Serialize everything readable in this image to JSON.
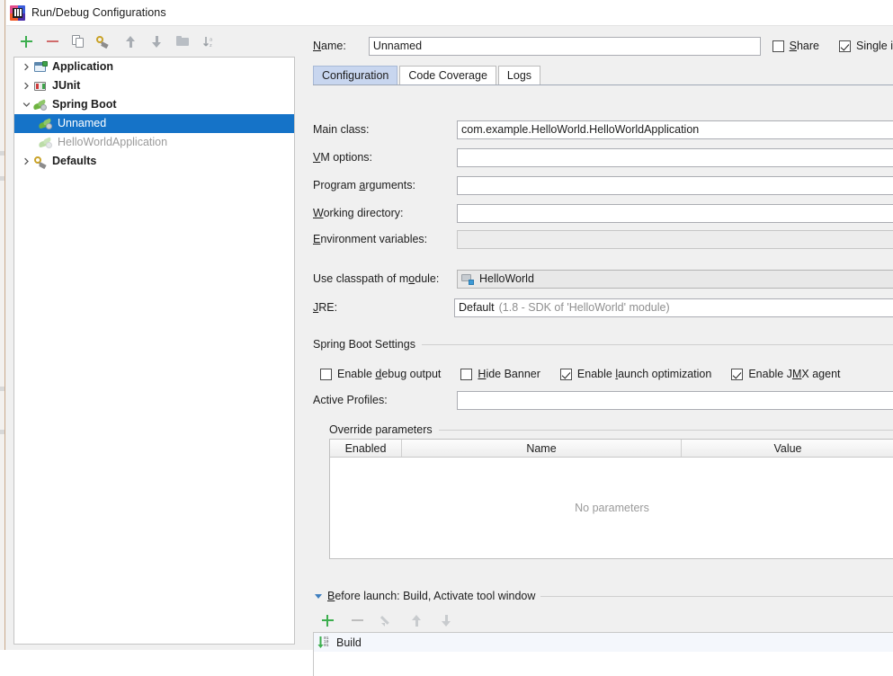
{
  "window": {
    "title": "Run/Debug Configurations",
    "logo_icon": "intellij-idea-logo"
  },
  "tree_toolbar": {
    "buttons": [
      {
        "name": "add",
        "icon": "plus-icon"
      },
      {
        "name": "remove",
        "icon": "minus-icon"
      },
      {
        "name": "copy",
        "icon": "copy-icon"
      },
      {
        "name": "edit-defaults",
        "icon": "wrench-icon"
      },
      {
        "name": "move-up",
        "icon": "arrow-up-icon"
      },
      {
        "name": "move-down",
        "icon": "arrow-down-icon"
      },
      {
        "name": "create-folder",
        "icon": "folder-icon"
      },
      {
        "name": "sort",
        "icon": "sort-az-icon"
      }
    ]
  },
  "tree": {
    "items": [
      {
        "label": "Application",
        "icon": "application-icon",
        "twisty": "collapsed",
        "level": 0,
        "bold": true,
        "selected": false,
        "muted": false
      },
      {
        "label": "JUnit",
        "icon": "junit-icon",
        "twisty": "collapsed",
        "level": 0,
        "bold": true,
        "selected": false,
        "muted": false
      },
      {
        "label": "Spring Boot",
        "icon": "spring-leaf-icon",
        "twisty": "expanded",
        "level": 0,
        "bold": true,
        "selected": false,
        "muted": false
      },
      {
        "label": "Unnamed",
        "icon": "spring-leaf-icon",
        "twisty": "none",
        "level": 1,
        "bold": false,
        "selected": true,
        "muted": false
      },
      {
        "label": "HelloWorldApplication",
        "icon": "spring-leaf-icon",
        "twisty": "none",
        "level": 1,
        "bold": false,
        "selected": false,
        "muted": true
      },
      {
        "label": "Defaults",
        "icon": "wrench-icon",
        "twisty": "collapsed",
        "level": 0,
        "bold": true,
        "selected": false,
        "muted": false
      }
    ]
  },
  "header": {
    "name_label": "Name:",
    "name_label_mnemonic": "N",
    "name_value": "Unnamed",
    "share_label": "Share",
    "share_mnemonic": "S",
    "share_checked": false,
    "single_instance_label": "Single i",
    "single_instance_checked": true
  },
  "tabs": [
    {
      "label": "Configuration",
      "active": true
    },
    {
      "label": "Code Coverage",
      "active": false
    },
    {
      "label": "Logs",
      "active": false
    }
  ],
  "configuration": {
    "fields": [
      {
        "label": "Main class:",
        "mnemonic": "",
        "value": "com.example.HelloWorld.HelloWorldApplication",
        "kind": "text",
        "disabled": false
      },
      {
        "label": "VM options:",
        "mnemonic": "V",
        "value": "",
        "kind": "text",
        "disabled": false
      },
      {
        "label": "Program arguments:",
        "mnemonic": "a",
        "value": "",
        "kind": "text",
        "disabled": false
      },
      {
        "label": "Working directory:",
        "mnemonic": "W",
        "value": "",
        "kind": "text",
        "disabled": false
      },
      {
        "label": "Environment variables:",
        "mnemonic": "E",
        "value": "",
        "kind": "text",
        "disabled": true
      }
    ],
    "module_label": "Use classpath of module:",
    "module_mnemonic": "o",
    "module_value": "HelloWorld",
    "module_icon": "module-icon",
    "jre_label": "JRE:",
    "jre_mnemonic": "J",
    "jre_value": "Default",
    "jre_hint": "(1.8 - SDK of 'HelloWorld' module)"
  },
  "spring_boot_settings": {
    "group_title": "Spring Boot Settings",
    "checkboxes": [
      {
        "label": "Enable debug output",
        "mnemonic": "d",
        "checked": false
      },
      {
        "label": "Hide Banner",
        "mnemonic": "H",
        "checked": false
      },
      {
        "label": "Enable launch optimization",
        "mnemonic": "l",
        "checked": true
      },
      {
        "label": "Enable JMX agent",
        "mnemonic": "M",
        "checked": true
      }
    ],
    "active_profiles_label": "Active Profiles:",
    "active_profiles_value": ""
  },
  "override_parameters": {
    "group_title": "Override parameters",
    "columns": [
      "Enabled",
      "Name",
      "Value"
    ],
    "rows": [],
    "empty_text": "No parameters"
  },
  "before_launch": {
    "title": "Before launch: Build, Activate tool window",
    "title_mnemonic": "B",
    "toolbar": [
      {
        "name": "add",
        "icon": "plus-icon",
        "enabled": true
      },
      {
        "name": "remove",
        "icon": "minus-icon",
        "enabled": false
      },
      {
        "name": "edit",
        "icon": "pencil-icon",
        "enabled": false
      },
      {
        "name": "move-up",
        "icon": "arrow-up-icon",
        "enabled": false
      },
      {
        "name": "move-down",
        "icon": "arrow-down-icon",
        "enabled": false
      }
    ],
    "tasks": [
      {
        "label": "Build",
        "icon": "build-icon"
      }
    ]
  },
  "colors": {
    "selection_blue": "#1573c8",
    "active_tab": "#c8d6ef",
    "spring_green": "#6db33f",
    "panel_bg": "#f0f0f0"
  }
}
